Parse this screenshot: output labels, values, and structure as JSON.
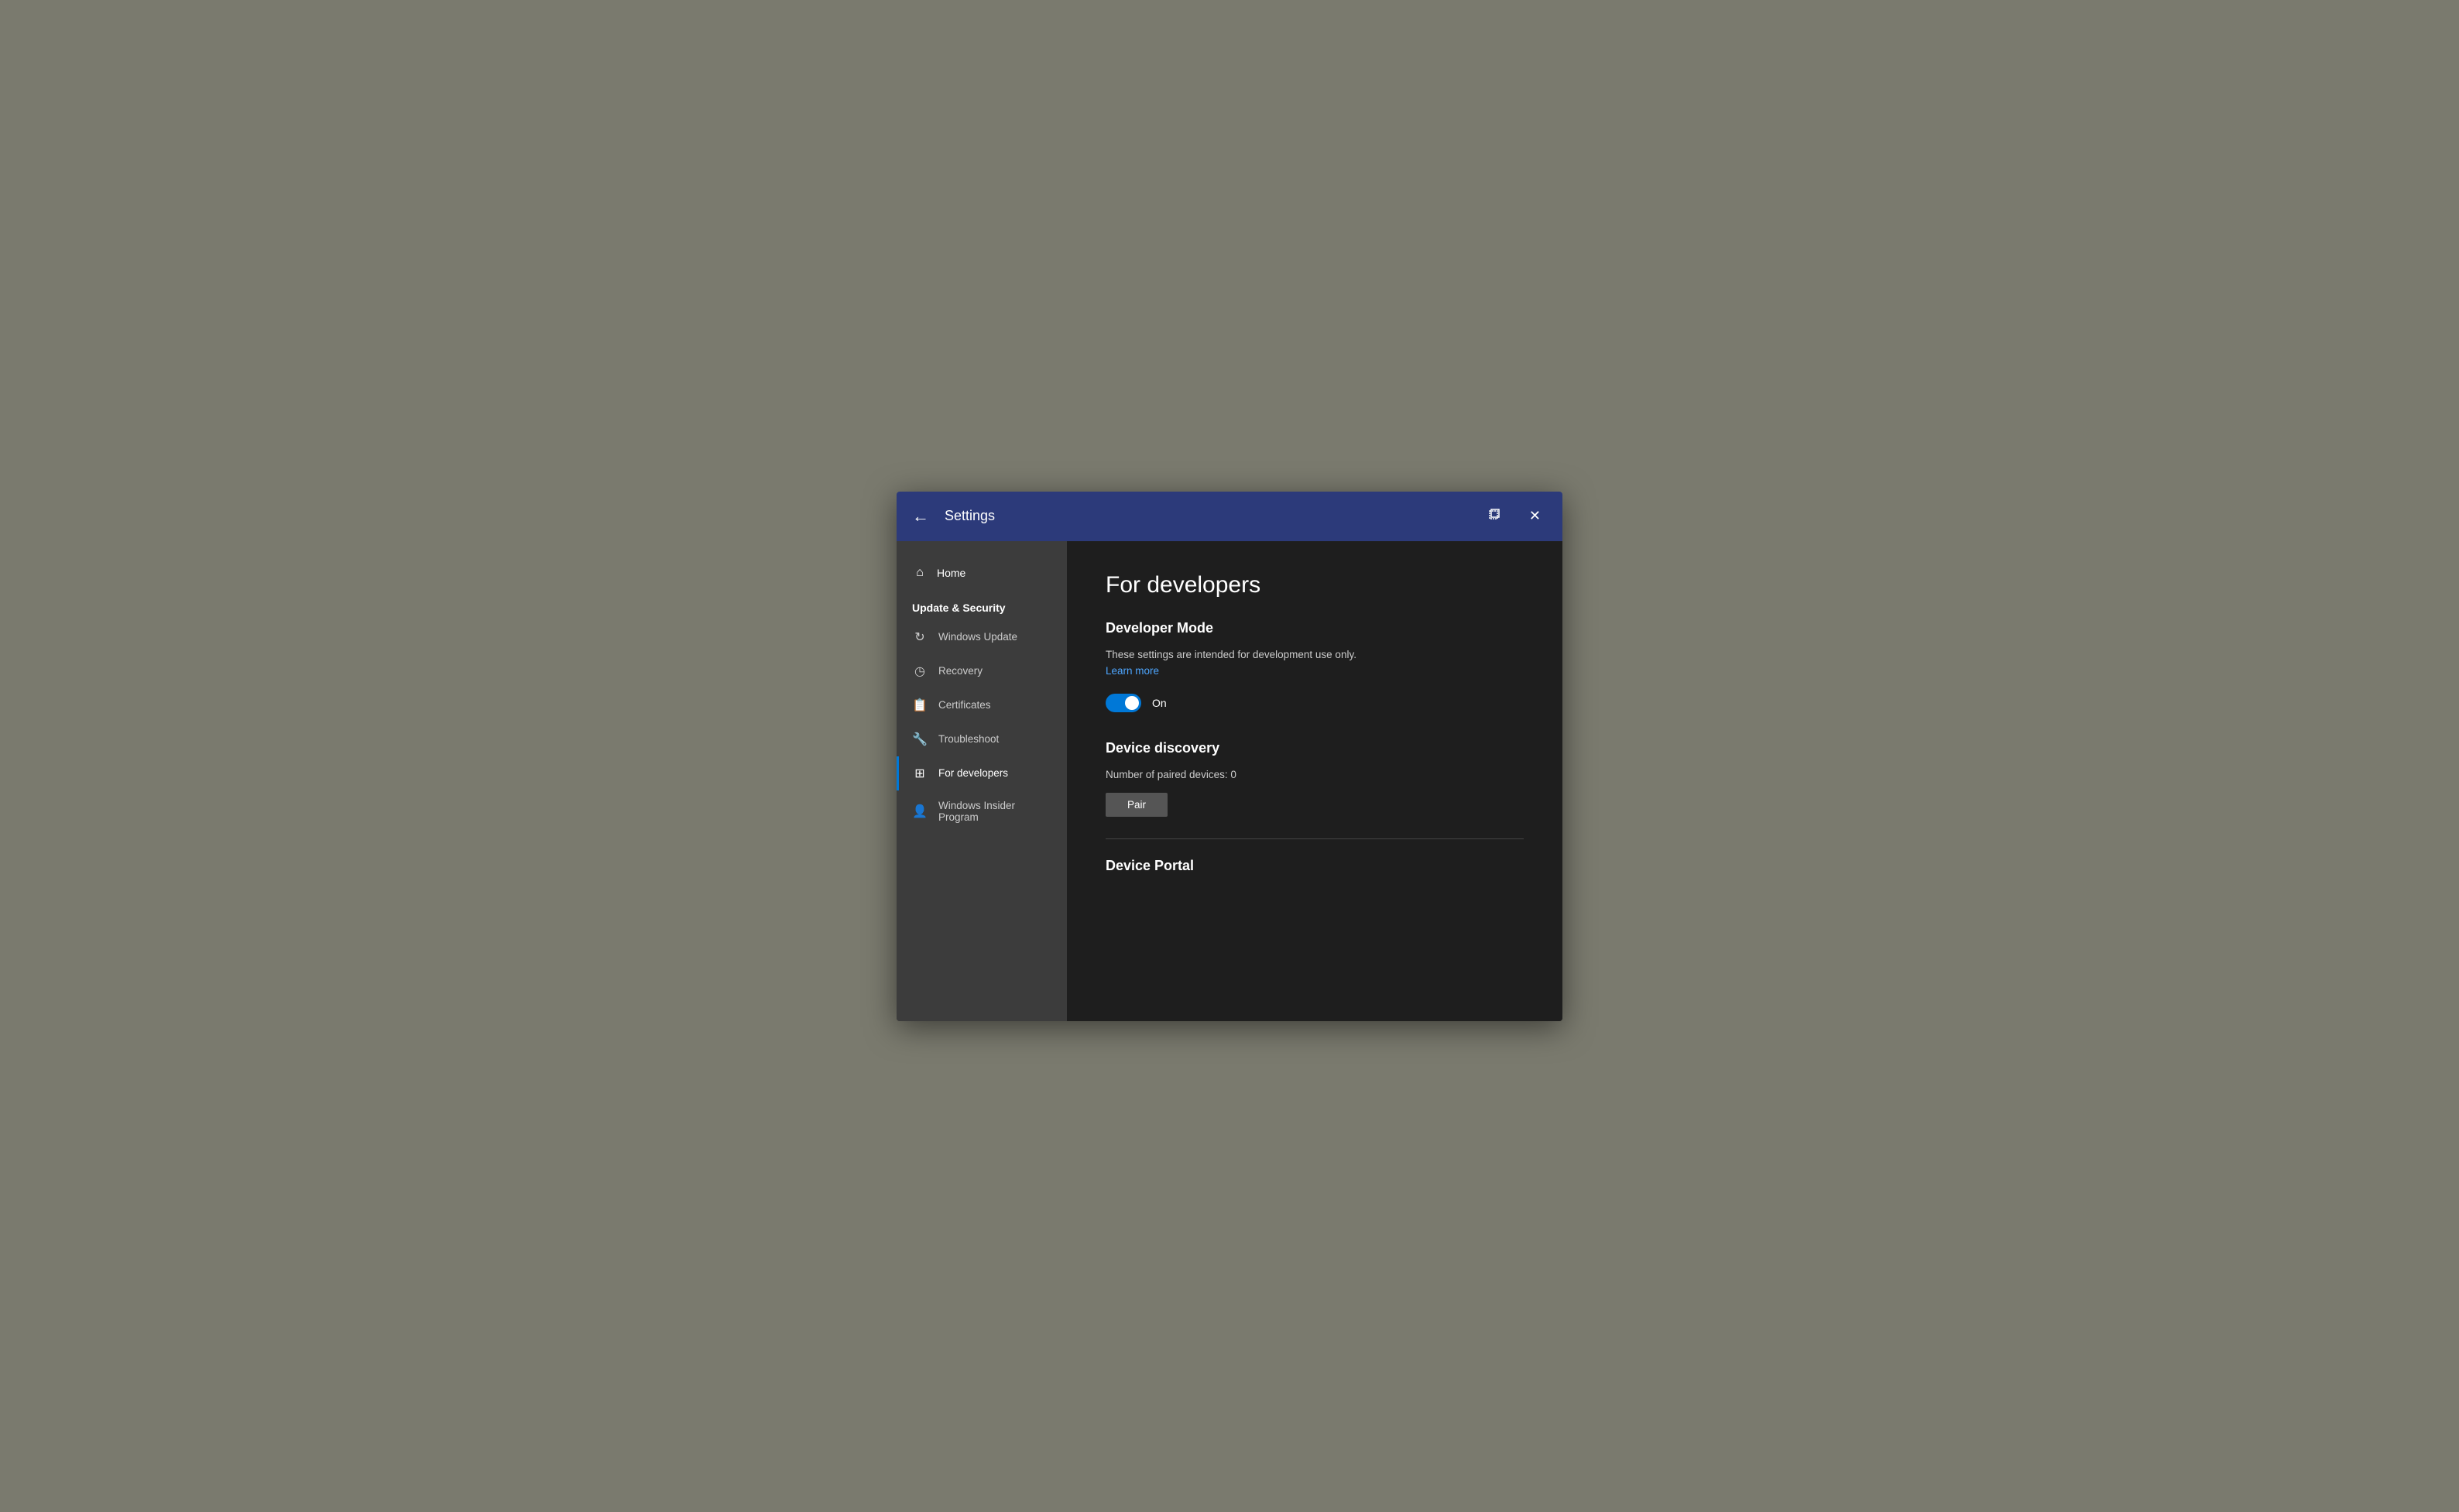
{
  "titlebar": {
    "back_label": "←",
    "title": "Settings",
    "restore_icon": "⬜",
    "close_icon": "✕"
  },
  "sidebar": {
    "home_label": "Home",
    "section_label": "Update & Security",
    "items": [
      {
        "id": "windows-update",
        "label": "Windows Update",
        "icon": "↻",
        "active": false
      },
      {
        "id": "recovery",
        "label": "Recovery",
        "icon": "⏮",
        "active": false
      },
      {
        "id": "certificates",
        "label": "Certificates",
        "icon": "🖹",
        "active": false
      },
      {
        "id": "troubleshoot",
        "label": "Troubleshoot",
        "icon": "🔑",
        "active": false
      },
      {
        "id": "for-developers",
        "label": "For developers",
        "icon": "⊞",
        "active": true
      },
      {
        "id": "windows-insider",
        "label": "Windows Insider Program",
        "icon": "👤",
        "active": false
      }
    ]
  },
  "main": {
    "page_title": "For developers",
    "developer_mode": {
      "section_title": "Developer Mode",
      "description": "These settings are intended for development use only.",
      "learn_more": "Learn more",
      "toggle_state": "On"
    },
    "device_discovery": {
      "section_title": "Device discovery",
      "paired_devices_text": "Number of paired devices: 0",
      "pair_button_label": "Pair"
    },
    "device_portal": {
      "section_title": "Device Portal"
    }
  }
}
